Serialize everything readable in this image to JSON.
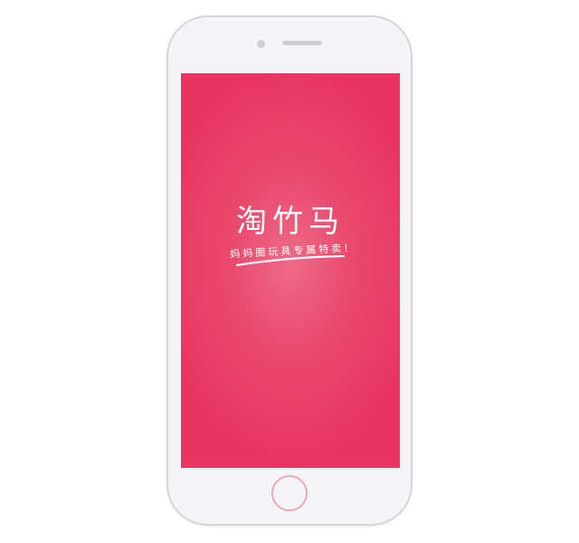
{
  "splash": {
    "app_name": "淘竹马",
    "tagline": "妈妈圈玩具专属特卖!"
  },
  "colors": {
    "screen_background": "#e83561",
    "screen_glow": "#ee6a88",
    "text": "#ffffff",
    "phone_body": "#f5f5f7",
    "home_button_ring": "#e8a8be"
  },
  "icons": {
    "camera": "front-camera-icon",
    "speaker": "speaker-grille-icon",
    "home": "home-button"
  }
}
